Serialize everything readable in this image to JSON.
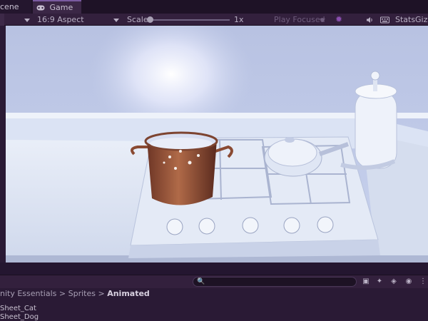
{
  "tabs": [
    {
      "label": "cene",
      "active": false
    },
    {
      "label": "Game",
      "active": true
    }
  ],
  "toolbar": {
    "aspect_label": "16:9 Aspect",
    "scale_label": "Scale",
    "scale_value": "1x",
    "play_focused_label": "Play Focused",
    "stats_label": "Stats",
    "gizmos_label": "Giz"
  },
  "breadcrumb": {
    "items": [
      "nity Essentials",
      "Sprites"
    ],
    "current": "Animated",
    "separator": ">"
  },
  "files": [
    "Sheet_Cat",
    "Sheet_Dog"
  ],
  "colors": {
    "accent": "#7a5aa0",
    "panel_bg": "#2a1a35",
    "toolbar_bg": "#33203d",
    "scene_sky": "#c9d2ec",
    "pot": "#9a5a3c"
  }
}
